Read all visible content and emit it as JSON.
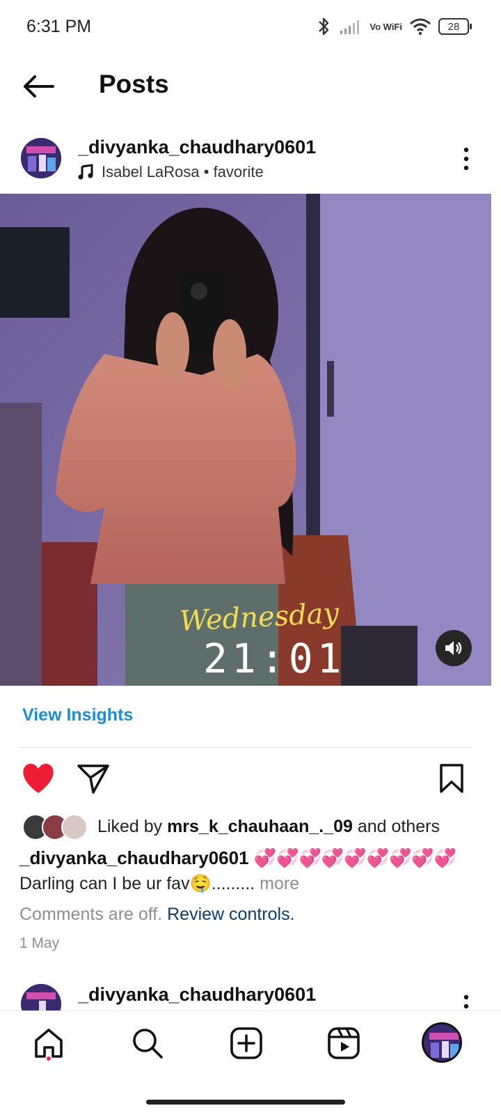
{
  "status_bar": {
    "time": "6:31 PM",
    "network_label": "Vo WiFi",
    "battery": "28"
  },
  "header": {
    "title": "Posts"
  },
  "post": {
    "username": "_divyanka_chaudhary0601",
    "audio": "Isabel LaRosa • favorite",
    "overlay_day": "Wednesday",
    "overlay_time": "21:01",
    "view_insights": "View Insights",
    "liked_by_prefix": "Liked by ",
    "liked_by_user": "mrs_k_chauhaan_._09",
    "liked_by_suffix": " and others",
    "caption_user": "_divyanka_chaudhary0601",
    "caption_emojis": "💞💞💞💞💞💞💞💞💞",
    "caption_text": "Darling can I be ur fav🤤.........",
    "caption_more": " more",
    "comments_off": "Comments are off. ",
    "review_controls": "Review controls.",
    "date": "1 May"
  },
  "next_post": {
    "username": "_divyanka_chaudhary0601"
  },
  "nav": {
    "items": [
      "home-icon",
      "search-icon",
      "create-icon",
      "reels-icon",
      "profile-avatar"
    ]
  },
  "colors": {
    "accent_blue": "#1a8fd6",
    "like_red": "#ee1d36",
    "link_dark_blue": "#0b3d6e",
    "muted_gray": "#8e8e8e"
  }
}
